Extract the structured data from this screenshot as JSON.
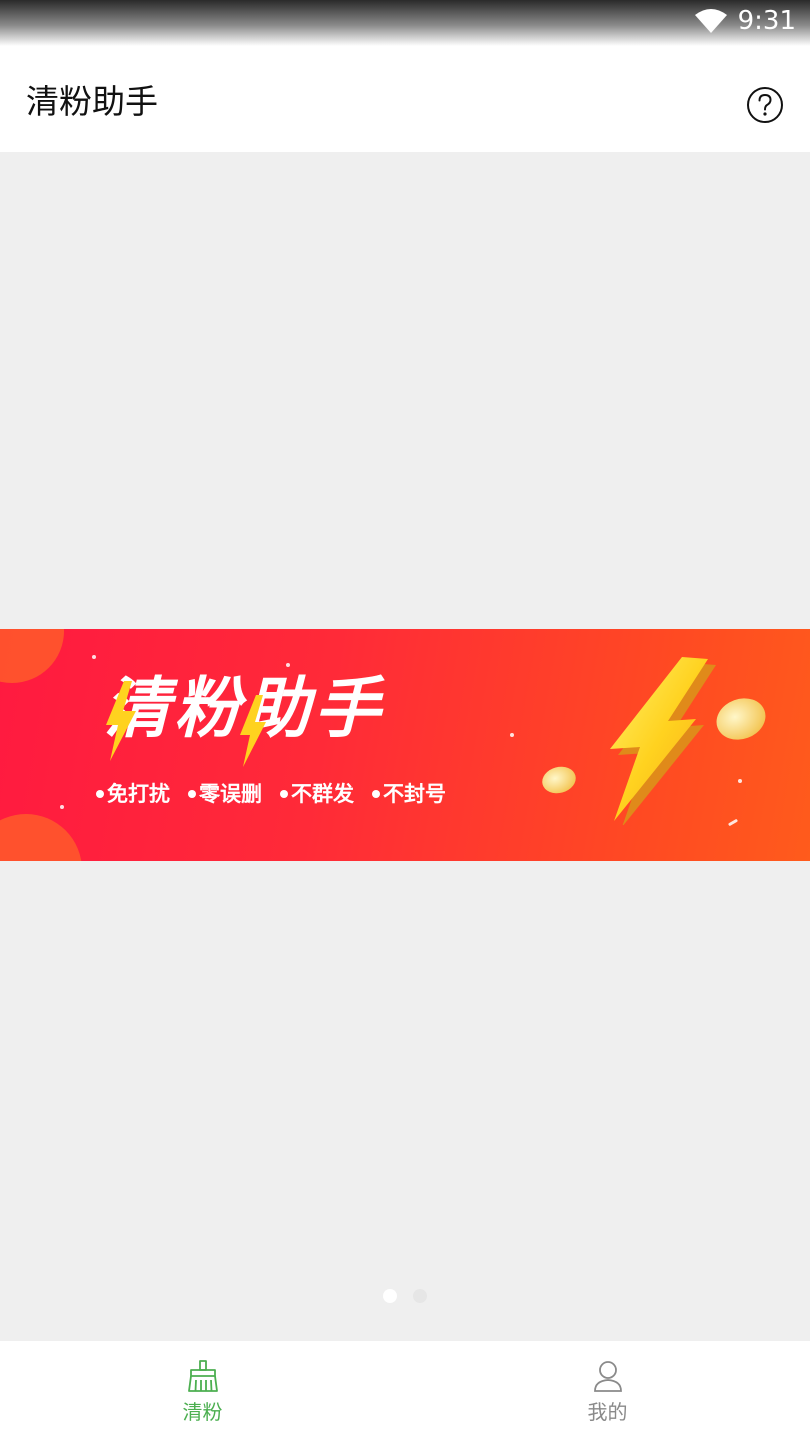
{
  "status_bar": {
    "time": "9:31",
    "wifi_icon": "wifi-icon"
  },
  "app_bar": {
    "title": "清粉助手",
    "help_icon": "help-circle-icon"
  },
  "banner": {
    "title": "清粉助手",
    "features": [
      "免打扰",
      "零误删",
      "不群发",
      "不封号"
    ],
    "colors": {
      "gradient_start": "#ff1a40",
      "gradient_end": "#ff5b1c",
      "bolt": "#ffd21f"
    }
  },
  "pager": {
    "page_count": 2,
    "active_index": 0
  },
  "bottom_nav": {
    "tabs": [
      {
        "label": "清粉",
        "icon": "broom-icon",
        "active": true
      },
      {
        "label": "我的",
        "icon": "user-icon",
        "active": false
      }
    ],
    "active_color": "#4caf50",
    "inactive_color": "#8a8a8a"
  }
}
